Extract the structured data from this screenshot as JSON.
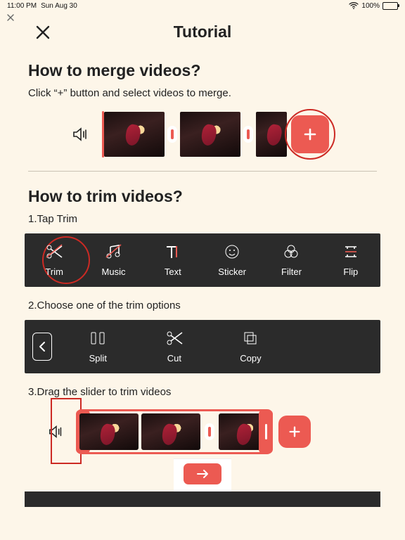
{
  "status": {
    "time": "11:00 PM",
    "date": "Sun Aug 30",
    "wifi_icon": "wifi-icon",
    "battery_pct": "100%"
  },
  "header": {
    "title": "Tutorial",
    "close_icon": "close-icon"
  },
  "sections": {
    "merge": {
      "title": "How to merge videos?",
      "body": "Click “+” button and select videos to merge."
    },
    "trim": {
      "title": "How to trim videos?",
      "step1": "1.Tap Trim",
      "step2": "2.Choose one of the trim options",
      "step3": "3.Drag the slider to trim videos"
    }
  },
  "toolbar1": [
    {
      "icon": "scissors-crossed-icon",
      "label": "Trim"
    },
    {
      "icon": "music-note-icon",
      "label": "Music"
    },
    {
      "icon": "text-icon",
      "label": "Text"
    },
    {
      "icon": "smiley-icon",
      "label": "Sticker"
    },
    {
      "icon": "rings-icon",
      "label": "Filter"
    },
    {
      "icon": "flip-icon",
      "label": "Flip"
    }
  ],
  "toolbar2": [
    {
      "icon": "chevron-left-icon",
      "label": ""
    },
    {
      "icon": "split-icon",
      "label": "Split"
    },
    {
      "icon": "scissors-icon",
      "label": "Cut"
    },
    {
      "icon": "copy-icon",
      "label": "Copy"
    }
  ],
  "icons": {
    "speaker": "speaker-icon",
    "plus": "plus-icon",
    "arrow_right": "arrow-right-icon"
  },
  "colors": {
    "accent": "#ec5a52",
    "background": "#fdf6e9",
    "toolbar_bg": "#2b2b2b",
    "highlight_ring": "#cc2a24"
  }
}
